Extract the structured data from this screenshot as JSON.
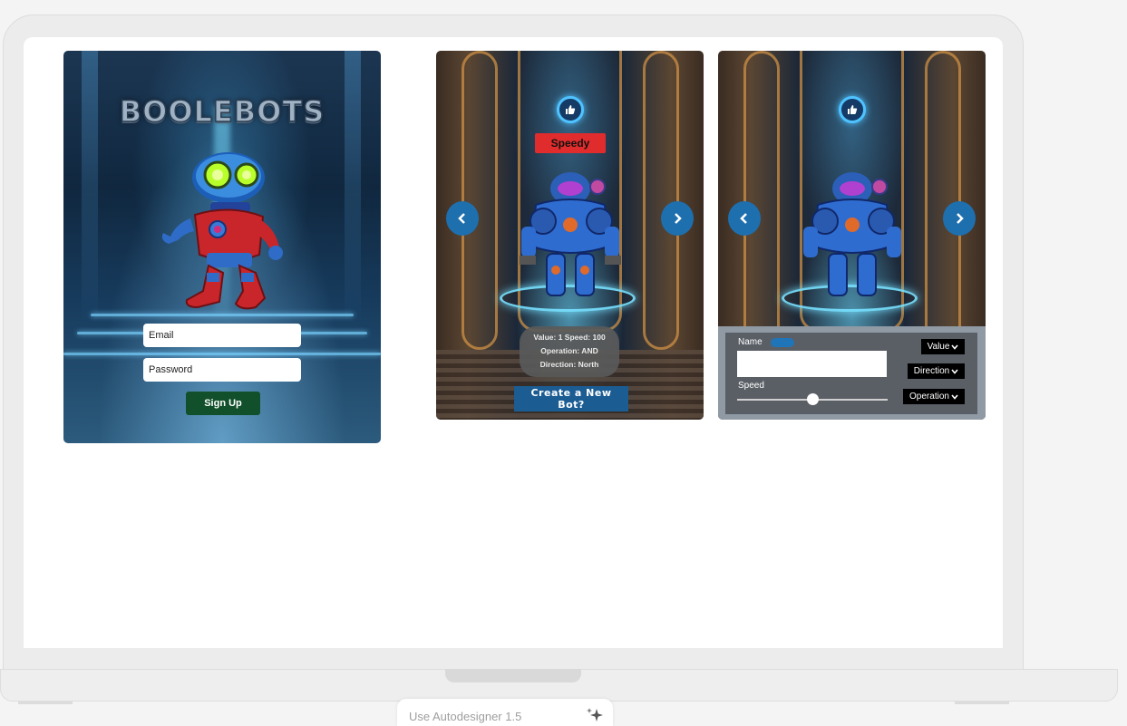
{
  "login": {
    "logo": "BOOLEBOTS",
    "email_placeholder": "Email",
    "password_placeholder": "Password",
    "signup_label": "Sign Up"
  },
  "bot_card": {
    "name": "Speedy",
    "stats_line1": "Value: 1  Speed: 100",
    "stats_line2": "Operation: AND",
    "stats_line3": "Direction: North",
    "create_label": "Create a New Bot?"
  },
  "editor": {
    "name_label": "Name",
    "speed_label": "Speed",
    "speed_level": 0.5,
    "value_dropdown": "Value",
    "direction_dropdown": "Direction",
    "operation_dropdown": "Operation"
  },
  "footer": {
    "autodesigner_label": "Use Autodesigner 1.5"
  },
  "icons": {
    "nav_left": "chevron-left-icon",
    "nav_right": "chevron-right-icon",
    "like": "thumbs-up-icon",
    "dropdown": "chevron-down-icon",
    "sparkle": "sparkle-icon"
  },
  "colors": {
    "signup": "#12502c",
    "name_badge": "#e02c2c",
    "create_button": "#1b5c93",
    "nav_button": "#1e6fae",
    "toggle": "#1f75b8"
  }
}
